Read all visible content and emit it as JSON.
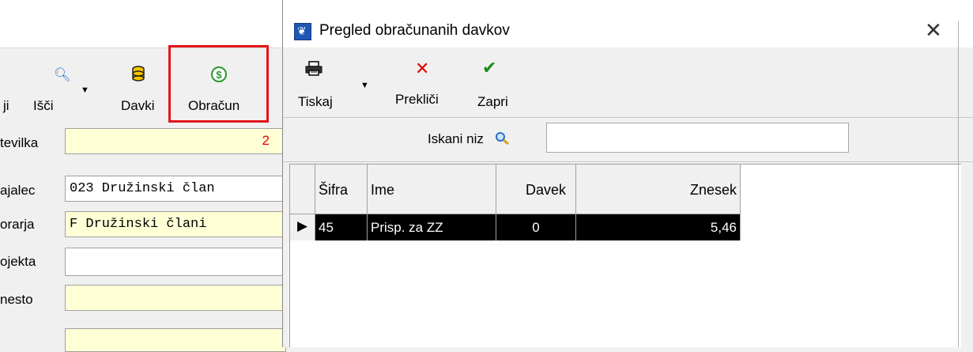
{
  "background": {
    "toolbar": {
      "items": [
        {
          "label": "ji"
        },
        {
          "label": "Išči"
        },
        {
          "label": "Davki"
        },
        {
          "label": "Obračun"
        }
      ]
    },
    "form": {
      "labels": [
        "tevilka",
        "ajalec",
        "orarja",
        "ojekta",
        "nesto"
      ],
      "number_value": "2",
      "ajalec_value": "023 Družinski član",
      "orarja_value": "F Družinski člani"
    }
  },
  "dialog": {
    "title": "Pregled obračunanih davkov",
    "toolbar": {
      "print_label": "Tiskaj",
      "cancel_label": "Prekliči",
      "close_label": "Zapri"
    },
    "search": {
      "label": "Iskani niz",
      "value": ""
    },
    "grid": {
      "columns": [
        "Šifra",
        "Ime",
        "Davek",
        "Znesek"
      ],
      "rows": [
        {
          "sifra": "45",
          "ime": "Prisp. za ZZ",
          "davek": "0",
          "znesek": "5,46"
        }
      ]
    }
  },
  "colors": {
    "highlight_box": "#e3141a",
    "required_field": "#ffffd6",
    "selected_row": "#000000",
    "number_text": "#e30000",
    "title_icon": "#1f57b5"
  },
  "icons": [
    "search-icon",
    "coins-icon",
    "dollar-icon",
    "printer-icon",
    "cancel-icon",
    "check-icon",
    "close-icon",
    "row-indicator-icon"
  ]
}
